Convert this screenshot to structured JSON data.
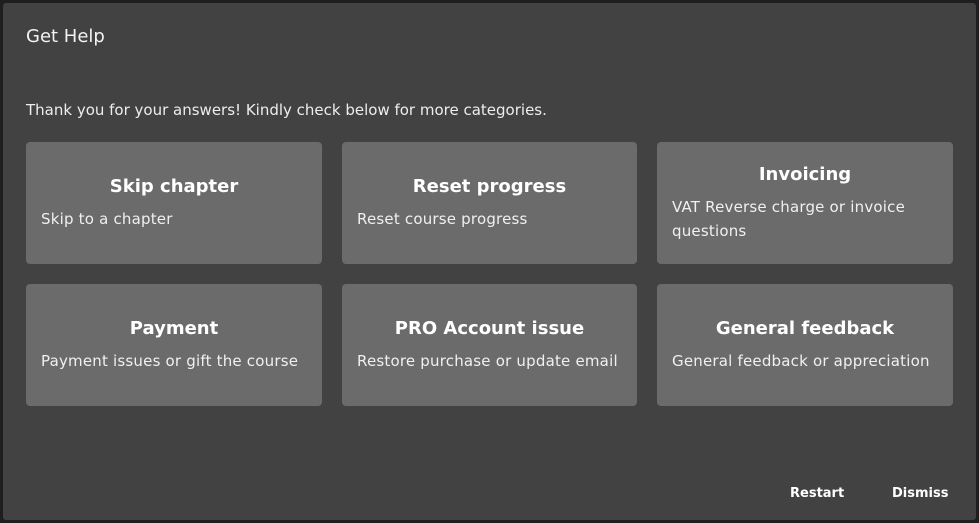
{
  "dialog": {
    "title": "Get Help",
    "intro": "Thank you for your answers! Kindly check below for more categories."
  },
  "categories": [
    {
      "title": "Skip chapter",
      "description": "Skip to a chapter"
    },
    {
      "title": "Reset progress",
      "description": "Reset course progress"
    },
    {
      "title": "Invoicing",
      "description": "VAT Reverse charge or invoice questions"
    },
    {
      "title": "Payment",
      "description": "Payment issues or gift the course"
    },
    {
      "title": "PRO Account issue",
      "description": "Restore purchase or update email"
    },
    {
      "title": "General feedback",
      "description": "General feedback or appreciation"
    }
  ],
  "footer": {
    "restart_label": "Restart",
    "dismiss_label": "Dismiss"
  },
  "colors": {
    "modal_bg": "#424242",
    "card_bg": "#6b6b6b",
    "text": "#ffffff"
  }
}
